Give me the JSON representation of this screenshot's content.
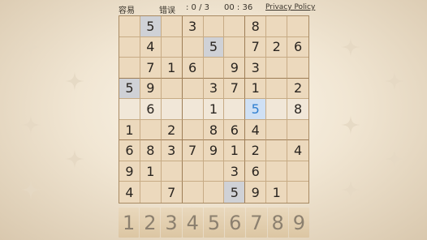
{
  "header": {
    "difficulty": "容易",
    "mistakes_label": "错误",
    "mistakes_count": ": 0 / 3",
    "timer": "00 : 36",
    "privacy_link": "Privacy Policy"
  },
  "board": {
    "cells": [
      [
        "",
        "5",
        "",
        "3",
        "",
        "",
        "8",
        "",
        ""
      ],
      [
        "",
        "4",
        "",
        "",
        "5",
        "",
        "7",
        "2",
        "6"
      ],
      [
        "",
        "7",
        "1",
        "6",
        "",
        "9",
        "3",
        "",
        ""
      ],
      [
        "5",
        "9",
        "",
        "",
        "3",
        "7",
        "1",
        "",
        "2"
      ],
      [
        "",
        "6",
        "",
        "",
        "1",
        "",
        "5",
        "",
        "8"
      ],
      [
        "1",
        "",
        "2",
        "",
        "8",
        "6",
        "4",
        "",
        ""
      ],
      [
        "6",
        "8",
        "3",
        "7",
        "9",
        "1",
        "2",
        "",
        "4"
      ],
      [
        "9",
        "1",
        "",
        "",
        "",
        "3",
        "6",
        "",
        ""
      ],
      [
        "4",
        "",
        "7",
        "",
        "",
        "5",
        "9",
        "1",
        ""
      ]
    ],
    "selected_cell": [
      4,
      6
    ],
    "same_value_cells": [
      [
        0,
        1
      ],
      [
        1,
        4
      ],
      [
        3,
        0
      ],
      [
        8,
        5
      ]
    ],
    "highlight_color_row": "#f1e7d8",
    "highlight_color_same": "#cfd1d6",
    "highlight_color_selected": "#cfe0f4"
  },
  "numpad": {
    "keys": [
      "1",
      "2",
      "3",
      "4",
      "5",
      "6",
      "7",
      "8",
      "9"
    ]
  },
  "decor": {
    "icon": "four-point-sparkle-icon"
  }
}
